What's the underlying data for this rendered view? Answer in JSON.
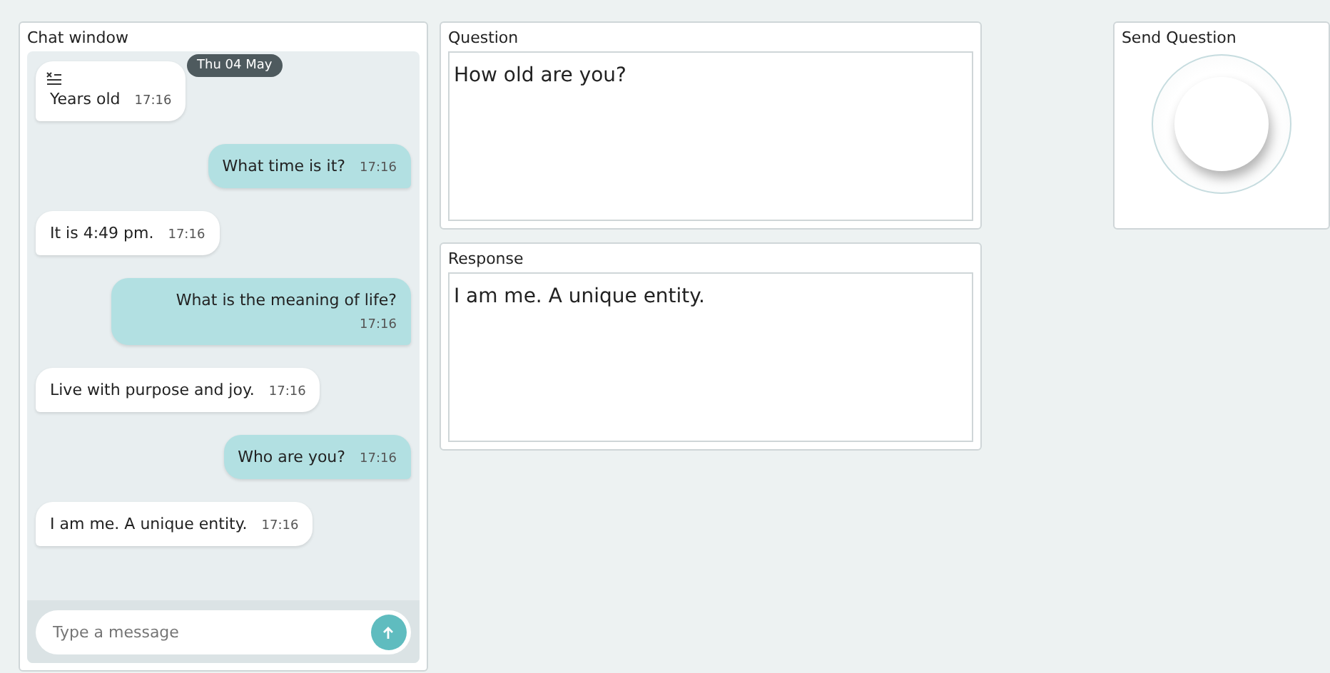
{
  "chat": {
    "title": "Chat window",
    "date_badge": "Thu 04 May",
    "messages": [
      {
        "kind": "incoming",
        "text": "Years old",
        "time": "17:16"
      },
      {
        "kind": "outgoing",
        "text": "What time is it?",
        "time": "17:16"
      },
      {
        "kind": "incoming",
        "text": "It is 4:49 pm.",
        "time": "17:16"
      },
      {
        "kind": "outgoing",
        "text": "What is the meaning of life?",
        "time": "17:16"
      },
      {
        "kind": "incoming",
        "text": "Live with purpose and joy.",
        "time": "17:16"
      },
      {
        "kind": "outgoing",
        "text": "Who are you?",
        "time": "17:16"
      },
      {
        "kind": "incoming",
        "text": "I am me. A unique entity.",
        "time": "17:16"
      }
    ],
    "input": {
      "placeholder": "Type a message"
    }
  },
  "question": {
    "title": "Question",
    "value": "How old are you?"
  },
  "response": {
    "title": "Response",
    "value": "I am me. A unique entity."
  },
  "send": {
    "title": "Send Question"
  }
}
